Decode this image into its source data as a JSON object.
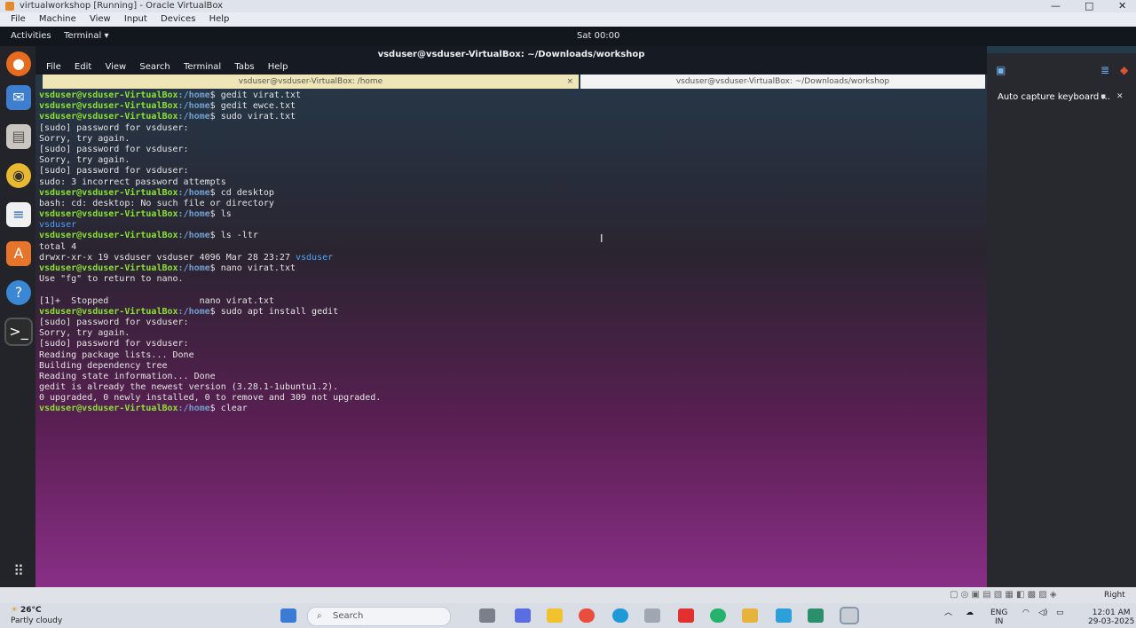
{
  "vbox": {
    "title": "virtualworkshop [Running] - Oracle VirtualBox",
    "menu": [
      "File",
      "Machine",
      "View",
      "Input",
      "Devices",
      "Help"
    ],
    "status_right": "Right Ct"
  },
  "ubuntu": {
    "activities": "Activities",
    "app_menu": "Terminal ▾",
    "clock": "Sat 00:00"
  },
  "terminal": {
    "window_title": "vsduser@vsduser-VirtualBox: ~/Downloads/workshop",
    "menu": [
      "File",
      "Edit",
      "View",
      "Search",
      "Terminal",
      "Tabs",
      "Help"
    ],
    "tabs": [
      {
        "label": "vsduser@vsduser-VirtualBox: /home"
      },
      {
        "label": "vsduser@vsduser-VirtualBox: ~/Downloads/workshop"
      }
    ],
    "prompt_user": "vsduser@vsduser-VirtualBox",
    "prompt_path": ":/home",
    "lines": [
      {
        "t": "p",
        "cmd": "$ gedit virat.txt"
      },
      {
        "t": "p",
        "cmd": "$ gedit ewce.txt"
      },
      {
        "t": "p",
        "cmd": "$ sudo virat.txt"
      },
      {
        "t": "o",
        "text": "[sudo] password for vsduser:"
      },
      {
        "t": "o",
        "text": "Sorry, try again."
      },
      {
        "t": "o",
        "text": "[sudo] password for vsduser:"
      },
      {
        "t": "o",
        "text": "Sorry, try again."
      },
      {
        "t": "o",
        "text": "[sudo] password for vsduser:"
      },
      {
        "t": "o",
        "text": "sudo: 3 incorrect password attempts"
      },
      {
        "t": "p",
        "cmd": "$ cd desktop"
      },
      {
        "t": "o",
        "text": "bash: cd: desktop: No such file or directory"
      },
      {
        "t": "p",
        "cmd": "$ ls"
      },
      {
        "t": "d",
        "text": "vsduser"
      },
      {
        "t": "p",
        "cmd": "$ ls -ltr"
      },
      {
        "t": "o",
        "text": "total 4"
      },
      {
        "t": "od",
        "text": "drwxr-xr-x 19 vsduser vsduser 4096 Mar 28 23:27 ",
        "dir": "vsduser"
      },
      {
        "t": "p",
        "cmd": "$ nano virat.txt"
      },
      {
        "t": "o",
        "text": "Use \"fg\" to return to nano."
      },
      {
        "t": "o",
        "text": ""
      },
      {
        "t": "o",
        "text": "[1]+  Stopped                 nano virat.txt"
      },
      {
        "t": "p",
        "cmd": "$ sudo apt install gedit"
      },
      {
        "t": "o",
        "text": "[sudo] password for vsduser:"
      },
      {
        "t": "o",
        "text": "Sorry, try again."
      },
      {
        "t": "o",
        "text": "[sudo] password for vsduser:"
      },
      {
        "t": "o",
        "text": "Reading package lists... Done"
      },
      {
        "t": "o",
        "text": "Building dependency tree"
      },
      {
        "t": "o",
        "text": "Reading state information... Done"
      },
      {
        "t": "o",
        "text": "gedit is already the newest version (3.28.1-1ubuntu1.2)."
      },
      {
        "t": "o",
        "text": "0 upgraded, 0 newly installed, 0 to remove and 309 not upgraded."
      },
      {
        "t": "p",
        "cmd": "$ clear"
      }
    ]
  },
  "right_panel": {
    "notification": "Auto capture keyboard ..."
  },
  "taskbar": {
    "weather_temp": "26°C",
    "weather_desc": "Partly cloudy",
    "search_placeholder": "Search",
    "lang": "ENG",
    "region": "IN",
    "time": "12:01 AM",
    "date": "29-03-2025"
  },
  "colors": {
    "prompt_green": "#8ae234",
    "prompt_blue": "#729fcf",
    "tab_active_bg": "#efe6b8",
    "tab_inactive_bg": "#f3f3f3"
  }
}
